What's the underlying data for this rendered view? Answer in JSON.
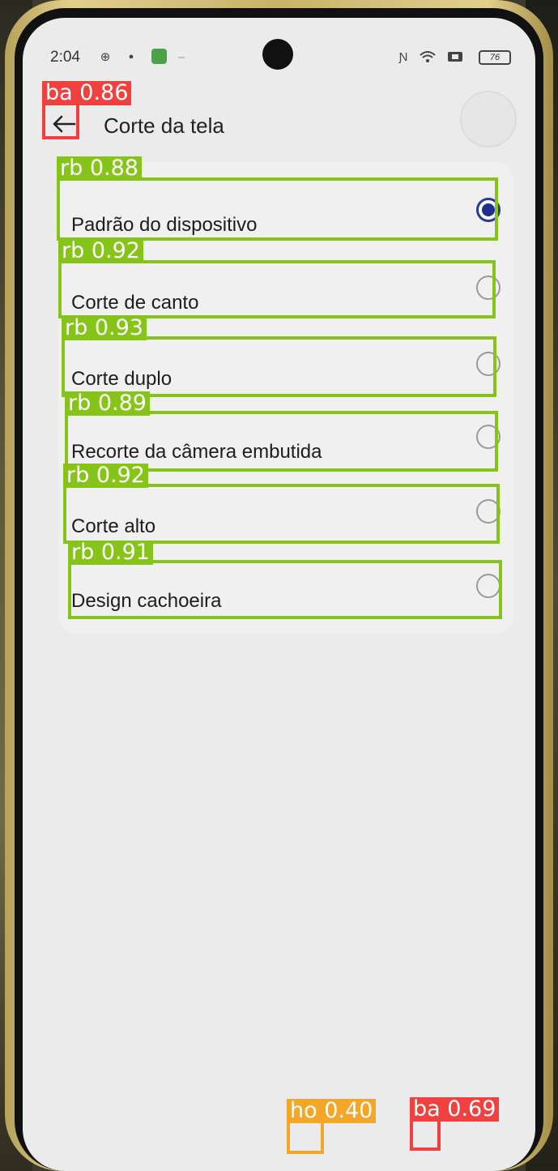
{
  "status_bar": {
    "time": "2:04",
    "battery": "76"
  },
  "header": {
    "back_icon": "arrow-left-icon",
    "title": "Corte da tela"
  },
  "options": [
    {
      "label": "Padrão do dispositivo",
      "selected": true
    },
    {
      "label": "Corte de canto",
      "selected": false
    },
    {
      "label": "Corte duplo",
      "selected": false
    },
    {
      "label": "Recorte da câmera embutida",
      "selected": false
    },
    {
      "label": "Corte alto",
      "selected": false
    },
    {
      "label": "Design cachoeira",
      "selected": false
    }
  ],
  "detections": [
    {
      "label": "ba 0.86",
      "color": "#f04040"
    },
    {
      "label": "rb 0.88",
      "color": "#86c41a"
    },
    {
      "label": "rb 0.92",
      "color": "#86c41a"
    },
    {
      "label": "rb 0.93",
      "color": "#86c41a"
    },
    {
      "label": "rb 0.89",
      "color": "#86c41a"
    },
    {
      "label": "rb 0.92",
      "color": "#86c41a"
    },
    {
      "label": "rb 0.91",
      "color": "#86c41a"
    },
    {
      "label": "ho 0.40",
      "color": "#f4a626"
    },
    {
      "label": "ba 0.69",
      "color": "#f04040"
    }
  ]
}
